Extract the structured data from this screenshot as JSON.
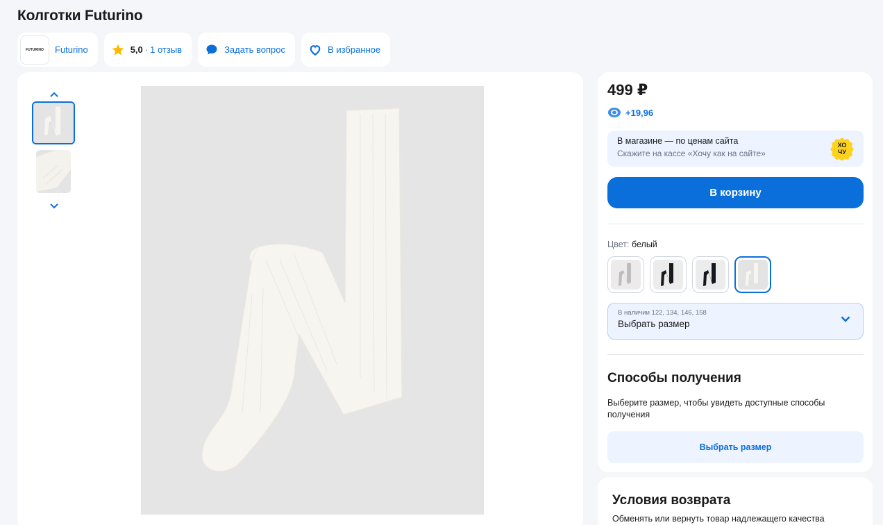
{
  "product": {
    "title": "Колготки Futurino"
  },
  "chips": {
    "brand": {
      "logo_text": "FUTURINO",
      "name": "Futurino"
    },
    "rating": {
      "value": "5,0",
      "separator": "·",
      "reviews": "1 отзыв"
    },
    "ask": {
      "label": "Задать вопрос"
    },
    "favorite": {
      "label": "В избранное"
    }
  },
  "purchase": {
    "price": "499 ₽",
    "bonus": "+19,96",
    "promo": {
      "line1": "В магазине — по ценам сайта",
      "line2": "Скажите на кассе «Хочу как на сайте»",
      "badge": "ХОЧУ"
    },
    "cart_button": "В корзину",
    "color": {
      "label": "Цвет:",
      "value": "белый"
    },
    "swatches": [
      "светло-серый",
      "черный",
      "темно-синий",
      "белый"
    ],
    "size": {
      "availability": "В наличии 122, 134, 146, 158",
      "placeholder": "Выбрать размер"
    },
    "shipping": {
      "title": "Способы получения",
      "description": "Выберите размер, чтобы увидеть доступные способы получения",
      "button": "Выбрать размер"
    }
  },
  "returns": {
    "title": "Условия возврата",
    "description": "Обменять или вернуть товар надлежащего качества"
  },
  "colors": {
    "accent": "#0a6fdb",
    "background": "#f4f6fa",
    "promo_bg": "#edf3ff",
    "star": "#ffb800"
  }
}
